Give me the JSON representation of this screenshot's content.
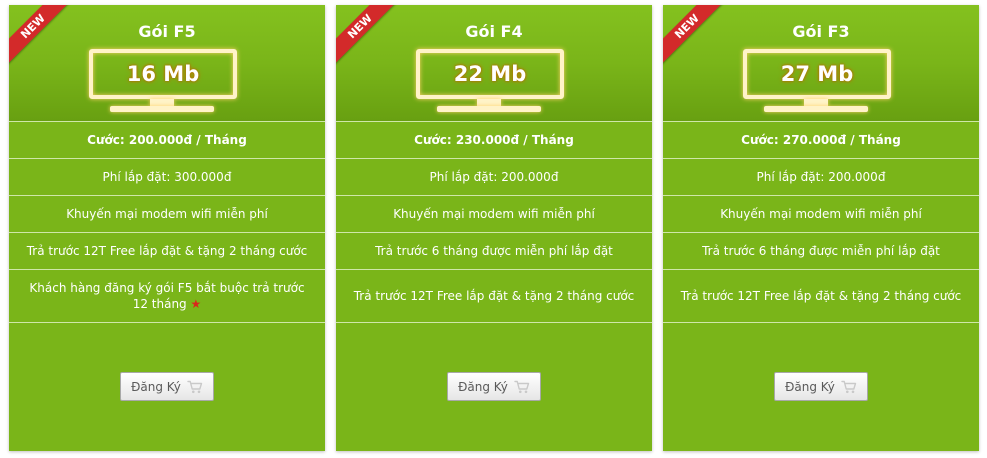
{
  "badge_label": "NEW",
  "register_label": "Đăng Ký",
  "colors": {
    "card": "#7ab519",
    "ribbon": "#d32a2a",
    "required_star": "#d9261c"
  },
  "icons": {
    "register": "cart-icon",
    "required": "star-icon"
  },
  "plans": [
    {
      "name": "Gói F5",
      "speed": "16 Mb",
      "price": "Cước: 200.000đ / Tháng",
      "install_fee": "Phí lắp đặt: 300.000đ",
      "promo": "Khuyến mại modem wifi miễn phí",
      "prepay_offer": "Trả trước 12T Free lắp đặt & tặng 2 tháng cước",
      "note": "Khách hàng đăng ký gói F5 bắt buộc trả trước 12 tháng"
    },
    {
      "name": "Gói F4",
      "speed": "22 Mb",
      "price": "Cước: 230.000đ / Tháng",
      "install_fee": "Phí lắp đặt: 200.000đ",
      "promo": "Khuyến mại modem wifi miễn phí",
      "prepay_offer": "Trả trước 6 tháng được miễn phí lắp đặt",
      "note": "Trả trước 12T Free lắp đặt & tặng 2 tháng cước"
    },
    {
      "name": "Gói F3",
      "speed": "27 Mb",
      "price": "Cước: 270.000đ / Tháng",
      "install_fee": "Phí lắp đặt: 200.000đ",
      "promo": "Khuyến mại modem wifi miễn phí",
      "prepay_offer": "Trả trước 6 tháng được miễn phí lắp đặt",
      "note": "Trả trước 12T Free lắp đặt & tặng 2 tháng cước"
    }
  ]
}
